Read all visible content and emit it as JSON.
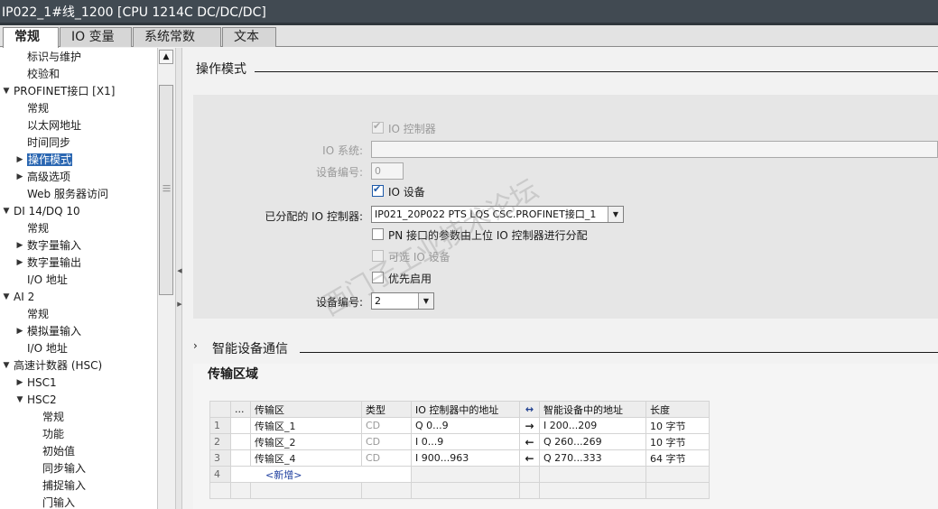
{
  "window": {
    "title": "IP022_1#线_1200 [CPU 1214C DC/DC/DC]"
  },
  "tabs": [
    {
      "label": "常规",
      "active": true
    },
    {
      "label": "IO 变量",
      "active": false
    },
    {
      "label": "系统常数",
      "active": false
    },
    {
      "label": "文本",
      "active": false
    }
  ],
  "nav": {
    "items": [
      {
        "label": "标识与维护",
        "level": 1
      },
      {
        "label": "校验和",
        "level": 1
      },
      {
        "label": "PROFINET接口 [X1]",
        "level": 0,
        "arrow": "▼"
      },
      {
        "label": "常规",
        "level": 1
      },
      {
        "label": "以太网地址",
        "level": 1
      },
      {
        "label": "时间同步",
        "level": 1
      },
      {
        "label": "操作模式",
        "level": 1,
        "arrow": "▶",
        "selected": true
      },
      {
        "label": "高级选项",
        "level": 1,
        "arrow": "▶"
      },
      {
        "label": "Web 服务器访问",
        "level": 1
      },
      {
        "label": "DI 14/DQ 10",
        "level": 0,
        "arrow": "▼"
      },
      {
        "label": "常规",
        "level": 1
      },
      {
        "label": "数字量输入",
        "level": 1,
        "arrow": "▶"
      },
      {
        "label": "数字量输出",
        "level": 1,
        "arrow": "▶"
      },
      {
        "label": "I/O 地址",
        "level": 1
      },
      {
        "label": "AI 2",
        "level": 0,
        "arrow": "▼"
      },
      {
        "label": "常规",
        "level": 1
      },
      {
        "label": "模拟量输入",
        "level": 1,
        "arrow": "▶"
      },
      {
        "label": "I/O 地址",
        "level": 1
      },
      {
        "label": "高速计数器 (HSC)",
        "level": 0,
        "arrow": "▼"
      },
      {
        "label": "HSC1",
        "level": 1,
        "arrow": "▶"
      },
      {
        "label": "HSC2",
        "level": 1,
        "arrow": "▼"
      },
      {
        "label": "常规",
        "level": 2
      },
      {
        "label": "功能",
        "level": 2
      },
      {
        "label": "初始值",
        "level": 2
      },
      {
        "label": "同步输入",
        "level": 2
      },
      {
        "label": "捕捉输入",
        "level": 2
      },
      {
        "label": "门输入",
        "level": 2
      }
    ]
  },
  "operating_mode": {
    "section_title": "操作模式",
    "io_controller_label": "IO 控制器",
    "io_system_label": "IO 系统:",
    "io_system_value": "",
    "device_number_label_1": "设备编号:",
    "device_number_value_1": "0",
    "io_device_label": "IO 设备",
    "assigned_controller_label": "已分配的 IO 控制器:",
    "assigned_controller_value": "IP021_20P022 PTS LQS CSC.PROFINET接口_1",
    "pn_param_label": "PN 接口的参数由上位 IO 控制器进行分配",
    "optional_device_label": "可选 IO 设备",
    "priority_startup_label": "优先启用",
    "device_number_label_2": "设备编号:",
    "device_number_value_2": "2"
  },
  "smart_device": {
    "section_title": "智能设备通信",
    "expander": "›"
  },
  "transfer": {
    "title": "传输区域",
    "columns": [
      "",
      "...",
      "传输区",
      "类型",
      "IO 控制器中的地址",
      "↔",
      "智能设备中的地址",
      "长度"
    ],
    "rows": [
      {
        "num": "1",
        "name": "传输区_1",
        "type": "CD",
        "ctrl_addr": "Q 0...9",
        "dir": "→",
        "dev_addr": "I 200...209",
        "length": "10 字节"
      },
      {
        "num": "2",
        "name": "传输区_2",
        "type": "CD",
        "ctrl_addr": "I 0...9",
        "dir": "←",
        "dev_addr": "Q 260...269",
        "length": "10 字节"
      },
      {
        "num": "3",
        "name": "传输区_4",
        "type": "CD",
        "ctrl_addr": "I 900...963",
        "dir": "←",
        "dev_addr": "Q 270...333",
        "length": "64 字节"
      }
    ],
    "add_row": {
      "num": "4",
      "label": "<新增>"
    }
  },
  "colors": {
    "titlebar": "#414a52",
    "selection": "#2b67b2",
    "accent": "#1e5aa8"
  }
}
